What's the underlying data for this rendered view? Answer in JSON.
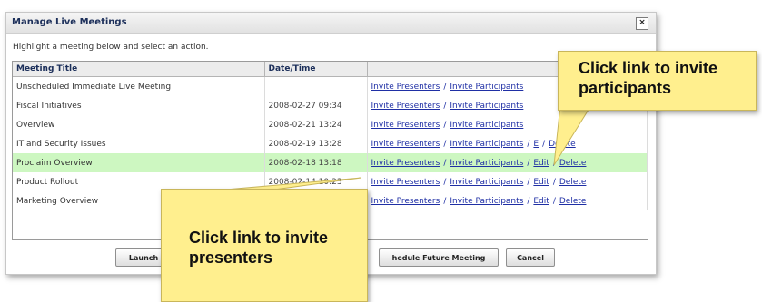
{
  "dialog": {
    "title": "Manage Live Meetings",
    "close_glyph": "×",
    "instruction": "Highlight a meeting below and select an action."
  },
  "table": {
    "columns": [
      "Meeting Title",
      "Date/Time",
      ""
    ],
    "rows": [
      {
        "title": "Unscheduled Immediate Live Meeting",
        "datetime": "",
        "invite_presenters": "Invite Presenters",
        "invite_participants": "Invite Participants",
        "selected": false
      },
      {
        "title": "Fiscal Initiatives",
        "datetime": "2008-02-27 09:34",
        "invite_presenters": "Invite Presenters",
        "invite_participants": "Invite Participants",
        "selected": false
      },
      {
        "title": "Overview",
        "datetime": "2008-02-21 13:24",
        "invite_presenters": "Invite Presenters",
        "invite_participants": "Invite Participants",
        "selected": false
      },
      {
        "title": "IT and Security Issues",
        "datetime": "2008-02-19 13:28",
        "invite_presenters": "Invite Presenters",
        "invite_participants": "Invite Participants",
        "edit": "E",
        "delete": "Delete",
        "selected": false
      },
      {
        "title": "Proclaim Overview",
        "datetime": "2008-02-18 13:18",
        "invite_presenters": "Invite Presenters",
        "invite_participants": "Invite Participants",
        "edit": "Edit",
        "delete": "Delete",
        "selected": true
      },
      {
        "title": "Product Rollout",
        "datetime": "2008-02-14 10:23",
        "invite_presenters": "Invite Presenters",
        "invite_participants": "Invite Participants",
        "edit": "Edit",
        "delete": "Delete",
        "selected": false
      },
      {
        "title": "Marketing Overview",
        "datetime": "",
        "invite_presenters": "Invite Presenters",
        "invite_participants": "Invite Participants",
        "edit": "Edit",
        "delete": "Delete",
        "selected": false
      }
    ]
  },
  "buttons": {
    "launch": "Launch L",
    "schedule": "hedule Future Meeting",
    "cancel": "Cancel"
  },
  "callouts": {
    "participants": "Click link to invite participants",
    "presenters": "Click link to invite presenters"
  },
  "colors": {
    "selected_row": "#cdf7c1",
    "link": "#1f2fa5",
    "callout": "#ffef8e"
  }
}
